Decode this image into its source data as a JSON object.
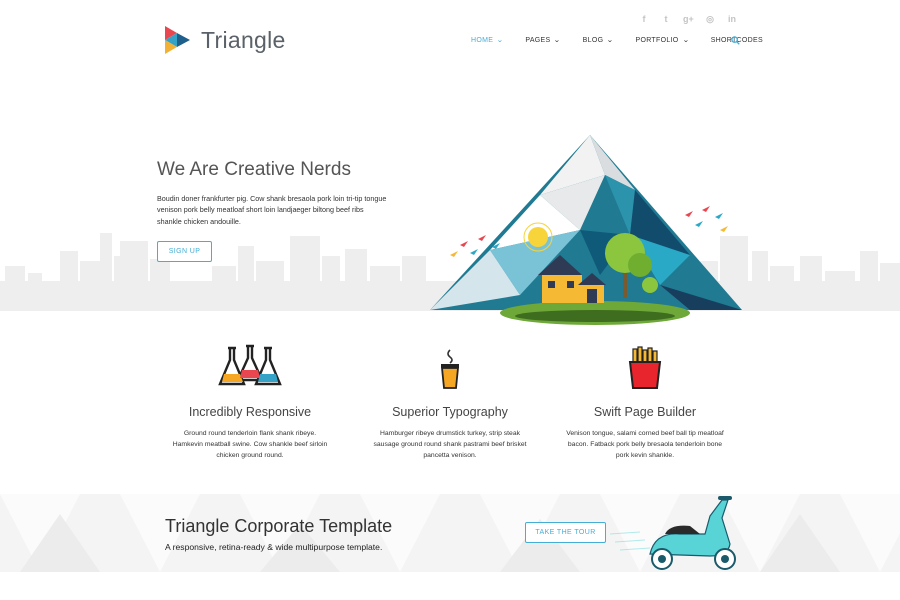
{
  "brand": {
    "name": "Triangle"
  },
  "social": [
    {
      "icon": "facebook-icon",
      "glyph": "f"
    },
    {
      "icon": "twitter-icon",
      "glyph": "t"
    },
    {
      "icon": "google-plus-icon",
      "glyph": "g+"
    },
    {
      "icon": "dribbble-icon",
      "glyph": "◎"
    },
    {
      "icon": "linkedin-icon",
      "glyph": "in"
    }
  ],
  "nav": {
    "items": [
      {
        "label": "HOME",
        "active": true,
        "dropdown": true
      },
      {
        "label": "PAGES",
        "dropdown": true
      },
      {
        "label": "BLOG",
        "dropdown": true
      },
      {
        "label": "PORTFOLIO",
        "dropdown": true
      },
      {
        "label": "SHORTCODES",
        "dropdown": false
      }
    ],
    "search_icon": "search-icon"
  },
  "hero": {
    "title": "We Are Creative Nerds",
    "description": "Boudin doner frankfurter pig. Cow shank bresaola pork loin tri-tip tongue venison pork belly meatloaf short loin landjaeger biltong beef ribs shankle chicken andouille.",
    "button": "SIGN UP"
  },
  "features": [
    {
      "icon": "flasks-icon",
      "title": "Incredibly Responsive",
      "text": "Ground round tenderloin flank shank ribeye. Hamkevin meatball swine. Cow shankle beef sirloin chicken ground round."
    },
    {
      "icon": "hot-drink-icon",
      "title": "Superior Typography",
      "text": "Hamburger ribeye drumstick turkey, strip steak sausage ground round shank pastrami beef brisket pancetta venison."
    },
    {
      "icon": "fries-icon",
      "title": "Swift Page Builder",
      "text": "Venison tongue, salami corned beef ball tip meatloaf bacon. Fatback pork belly bresaola tenderloin bone pork kevin shankle."
    }
  ],
  "cta": {
    "title": "Triangle Corporate Template",
    "subtitle": "A responsive, retina-ready & wide multipurpose template.",
    "button": "TAKE THE TOUR"
  },
  "colors": {
    "accent": "#45aed6",
    "text": "#333333",
    "band": "#f4f4f4"
  }
}
